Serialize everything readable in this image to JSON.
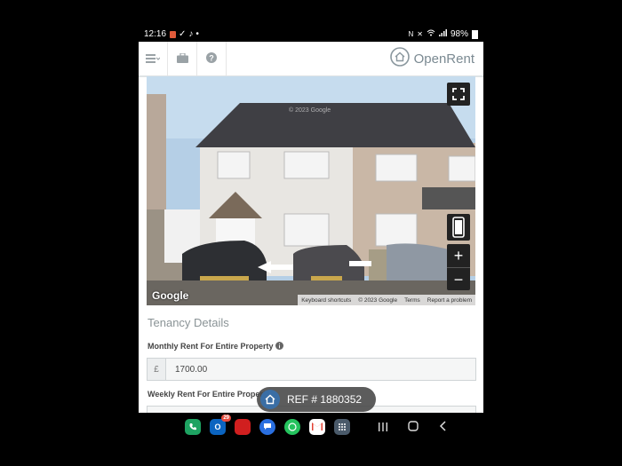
{
  "status": {
    "time": "12:16",
    "battery": "98%"
  },
  "header": {
    "logo_text": "OpenRent",
    "icons": [
      "menu-icon",
      "briefcase-icon",
      "help-icon"
    ]
  },
  "map": {
    "watermark": "© 2023 Google",
    "google_logo": "Google",
    "attribution": [
      "Keyboard shortcuts",
      "© 2023 Google",
      "Terms",
      "Report a problem"
    ],
    "zoom_in": "+",
    "zoom_out": "−"
  },
  "form": {
    "section_title": "Tenancy Details",
    "monthly_label": "Monthly Rent For Entire Property",
    "currency": "£",
    "monthly_value": "1700.00",
    "weekly_label": "Weekly Rent For Entire Property"
  },
  "ref": {
    "text": "REF # 1880352"
  },
  "dock": {
    "badge_count": "29",
    "apps": [
      "phone-app",
      "outlook-app",
      "red-app",
      "messages-app",
      "whatsapp-app",
      "gmail-app",
      "apps-grid"
    ]
  },
  "colors": {
    "accent": "#3a6ea5",
    "header_border": "#dfe4e6"
  }
}
